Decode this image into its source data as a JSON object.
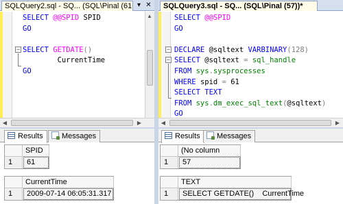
{
  "left": {
    "tab_title": "SQLQuery2.sql - SQ... (SQL\\Pinal (61",
    "tab_dropdown": "▾",
    "tab_close": "✕",
    "code": [
      [
        {
          "t": "SELECT ",
          "c": "kw"
        },
        {
          "t": "@@SPID",
          "c": "fn"
        },
        {
          "t": " SPID",
          "c": "blk"
        }
      ],
      [
        {
          "t": "GO",
          "c": "kw"
        }
      ],
      [],
      [
        {
          "t": "SELECT ",
          "c": "kw"
        },
        {
          "t": "GETDATE",
          "c": "fn"
        },
        {
          "t": "()",
          "c": "gray"
        }
      ],
      [
        {
          "t": "        CurrentTime",
          "c": "blk"
        }
      ],
      [
        {
          "t": "GO",
          "c": "kw"
        }
      ]
    ],
    "result_tabs": [
      "Results",
      "Messages"
    ],
    "grid1": {
      "header": "SPID",
      "row_num": "1",
      "value": "61"
    },
    "grid2": {
      "header": "CurrentTime",
      "row_num": "1",
      "value": "2009-07-14 06:05:31.317"
    }
  },
  "right": {
    "tab_title": "SQLQuery3.sql - SQ... (SQL\\Pinal (57))*",
    "code": [
      [
        {
          "t": "SELECT ",
          "c": "kw"
        },
        {
          "t": "@@SPID",
          "c": "fn"
        }
      ],
      [
        {
          "t": "GO",
          "c": "kw"
        }
      ],
      [],
      [
        {
          "t": "DECLARE ",
          "c": "kw"
        },
        {
          "t": "@sqltext ",
          "c": "blk"
        },
        {
          "t": "VARBINARY",
          "c": "kw"
        },
        {
          "t": "(128)",
          "c": "gray"
        }
      ],
      [
        {
          "t": "SELECT ",
          "c": "kw"
        },
        {
          "t": "@sqltext ",
          "c": "blk"
        },
        {
          "t": "= ",
          "c": "gray"
        },
        {
          "t": "sql_handle",
          "c": "grn"
        }
      ],
      [
        {
          "t": "FROM ",
          "c": "kw"
        },
        {
          "t": "sys",
          "c": "grn"
        },
        {
          "t": ".",
          "c": "gray"
        },
        {
          "t": "sysprocesses",
          "c": "grn"
        }
      ],
      [
        {
          "t": "WHERE ",
          "c": "kw"
        },
        {
          "t": "spid ",
          "c": "blk"
        },
        {
          "t": "= ",
          "c": "gray"
        },
        {
          "t": "61",
          "c": "blk"
        }
      ],
      [
        {
          "t": "SELECT ",
          "c": "kw"
        },
        {
          "t": "TEXT",
          "c": "kw"
        }
      ],
      [
        {
          "t": "FROM ",
          "c": "kw"
        },
        {
          "t": "sys",
          "c": "grn"
        },
        {
          "t": ".",
          "c": "gray"
        },
        {
          "t": "dm_exec_sql_text",
          "c": "grn"
        },
        {
          "t": "(",
          "c": "gray"
        },
        {
          "t": "@sqltext",
          "c": "blk"
        },
        {
          "t": ")",
          "c": "gray"
        }
      ],
      [
        {
          "t": "GO",
          "c": "kw"
        }
      ]
    ],
    "result_tabs": [
      "Results",
      "Messages"
    ],
    "grid1": {
      "header": "(No column name)",
      "row_num": "1",
      "value": "57"
    },
    "grid2": {
      "header": "TEXT",
      "row_num": "1",
      "value": "SELECT GETDATE()    CurrentTime"
    }
  },
  "icons": {
    "results": "results-grid-icon",
    "messages": "messages-icon",
    "outline_collapse": "minus-box-icon"
  },
  "colors": {
    "keyword": "#0000ff",
    "function": "#ff00ff",
    "object": "#008000",
    "operator": "#808080",
    "change_bar": "#ffee55",
    "tab_active": "#fffde8"
  }
}
